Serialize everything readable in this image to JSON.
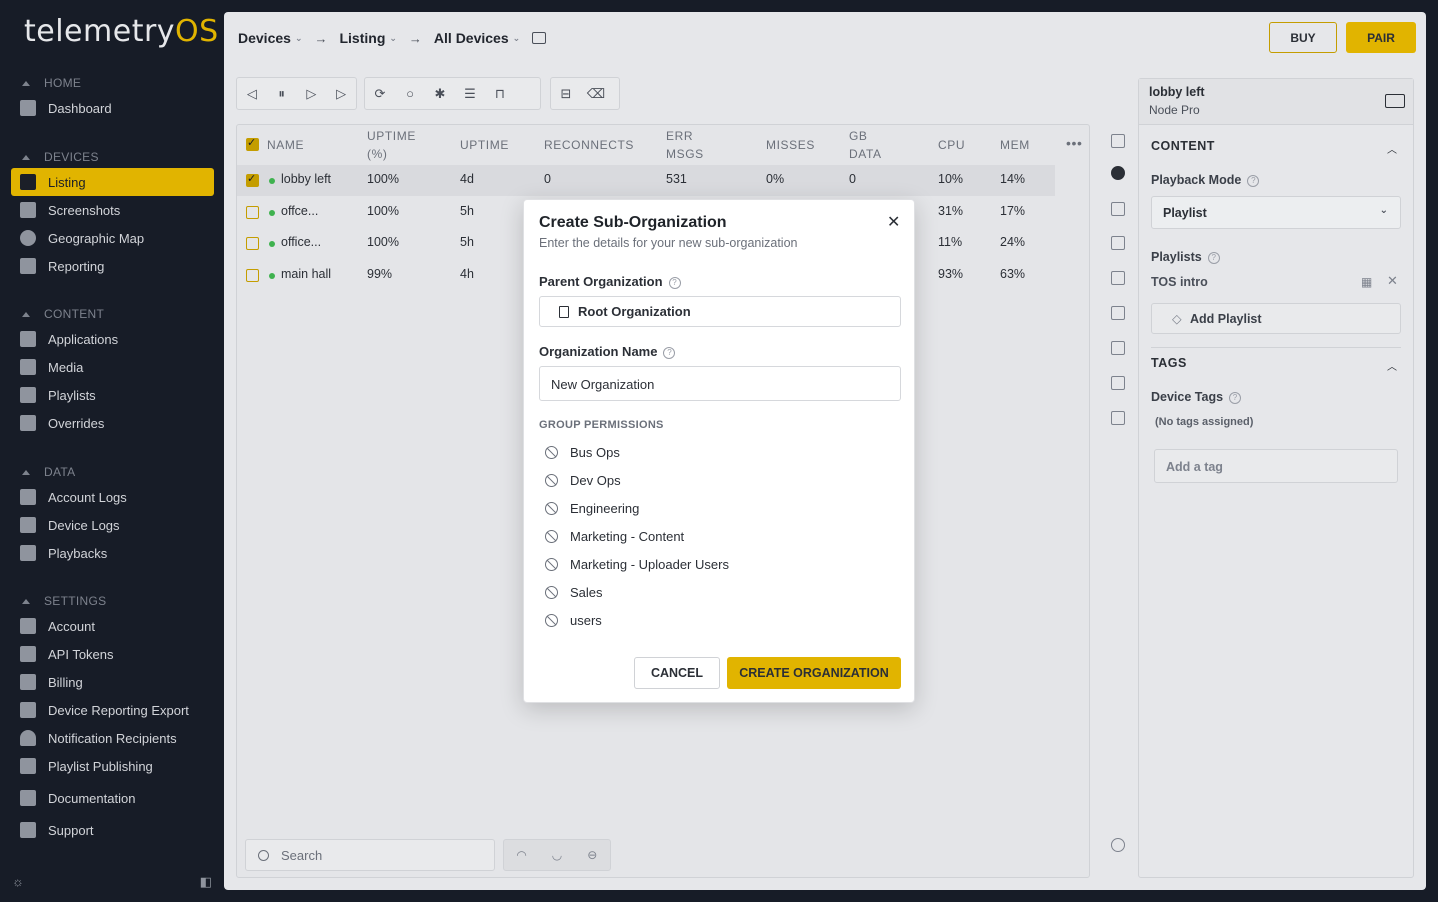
{
  "app": {
    "logo_main": "telemetry",
    "logo_accent": "OS"
  },
  "sidebar": {
    "sections": [
      {
        "title": "HOME",
        "items": [
          "Dashboard"
        ]
      },
      {
        "title": "DEVICES",
        "items": [
          "Listing",
          "Screenshots",
          "Geographic Map",
          "Reporting"
        ]
      },
      {
        "title": "CONTENT",
        "items": [
          "Applications",
          "Media",
          "Playlists",
          "Overrides"
        ]
      },
      {
        "title": "DATA",
        "items": [
          "Account Logs",
          "Device Logs",
          "Playbacks"
        ]
      },
      {
        "title": "SETTINGS",
        "items": [
          "Account",
          "API Tokens",
          "Billing",
          "Device Reporting Export",
          "Notification Recipients",
          "Playlist Publishing"
        ]
      }
    ],
    "extra": [
      "Documentation",
      "Support"
    ],
    "active": "Listing"
  },
  "breadcrumb": [
    "Devices",
    "Listing",
    "All Devices"
  ],
  "top_buttons": {
    "buy": "BUY",
    "pair": "PAIR"
  },
  "table": {
    "headers": [
      "NAME",
      "UPTIME (%)",
      "UPTIME",
      "RECONNECTS",
      "ERR MSGS",
      "MISSES",
      "GB DATA",
      "CPU",
      "MEM"
    ],
    "rows": [
      {
        "name": "lobby left",
        "uptime_pct": "100%",
        "uptime": "4d",
        "reconnects": "0",
        "err": "531",
        "misses": "0%",
        "gb": "0",
        "cpu": "10%",
        "mem": "14%",
        "checked": true
      },
      {
        "name": "offce...",
        "uptime_pct": "100%",
        "uptime": "5h",
        "cpu": "31%",
        "mem": "17%",
        "checked": false
      },
      {
        "name": "office...",
        "uptime_pct": "100%",
        "uptime": "5h",
        "cpu": "11%",
        "mem": "24%",
        "checked": false
      },
      {
        "name": "main hall",
        "uptime_pct": "99%",
        "uptime": "4h",
        "cpu": "93%",
        "mem": "63%",
        "checked": false
      }
    ],
    "search_placeholder": "Search"
  },
  "panel": {
    "device_name": "lobby left",
    "device_type": "Node Pro",
    "content_title": "CONTENT",
    "playback_mode_label": "Playback Mode",
    "playback_mode_value": "Playlist",
    "playlists_label": "Playlists",
    "playlist_item": "TOS intro",
    "add_playlist": "Add Playlist",
    "tags_title": "TAGS",
    "device_tags_label": "Device Tags",
    "no_tags": "(No tags assigned)",
    "add_tag_placeholder": "Add a tag"
  },
  "modal": {
    "title": "Create Sub-Organization",
    "subtitle": "Enter the details for your new sub-organization",
    "parent_label": "Parent Organization",
    "parent_value": "Root Organization",
    "name_label": "Organization Name",
    "name_value": "New Organization",
    "group_title": "GROUP PERMISSIONS",
    "permissions": [
      "Bus Ops",
      "Dev Ops",
      "Engineering",
      "Marketing - Content",
      "Marketing - Uploader Users",
      "Sales",
      "users"
    ],
    "cancel": "CANCEL",
    "create": "CREATE ORGANIZATION"
  }
}
